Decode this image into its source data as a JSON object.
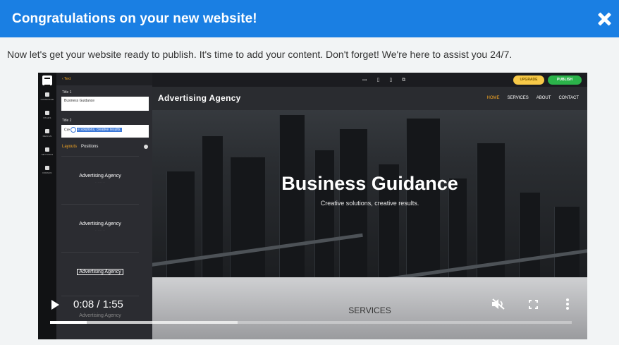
{
  "header": {
    "title": "Congratulations on your new website!",
    "close_icon": "close-icon"
  },
  "intro": "Now let's get your website ready to publish. It's time to add your content. Don't forget! We're here to assist you 24/7.",
  "video": {
    "progress_fraction": 0.07,
    "buffered_fraction": 0.36,
    "player": {
      "time": "0:08 / 1:55",
      "icons": [
        "play-icon",
        "mute-icon",
        "fullscreen-icon",
        "more-options-icon"
      ]
    },
    "builder": {
      "panel_header": "Text",
      "rail_items": [
        "HOMEPAGE",
        "PAGES",
        "DESIGN",
        "SETTINGS",
        "DOMAIN"
      ],
      "title1_label": "Title 1",
      "title1_value": "Business Guidance",
      "title2_label": "Title 2",
      "title2_prefix": "Cre",
      "title2_selected": "e solutions, creative results.",
      "tab_layouts": "Layouts",
      "tab_positions": "Positions",
      "layout_cards": [
        {
          "title": "Advertising Agency"
        },
        {
          "title": "Advertising Agency"
        },
        {
          "title": "Advertising Agency"
        },
        {
          "title": "Advertising Agency"
        }
      ],
      "upgrade_label": "UPGRADE",
      "publish_label": "PUBLISH"
    },
    "site": {
      "brand": "Advertising Agency",
      "nav": [
        "HOME",
        "SERVICES",
        "ABOUT",
        "CONTACT"
      ],
      "hero_title": "Business Guidance",
      "hero_subtitle": "Creative solutions, creative results.",
      "section_title": "SERVICES"
    }
  }
}
